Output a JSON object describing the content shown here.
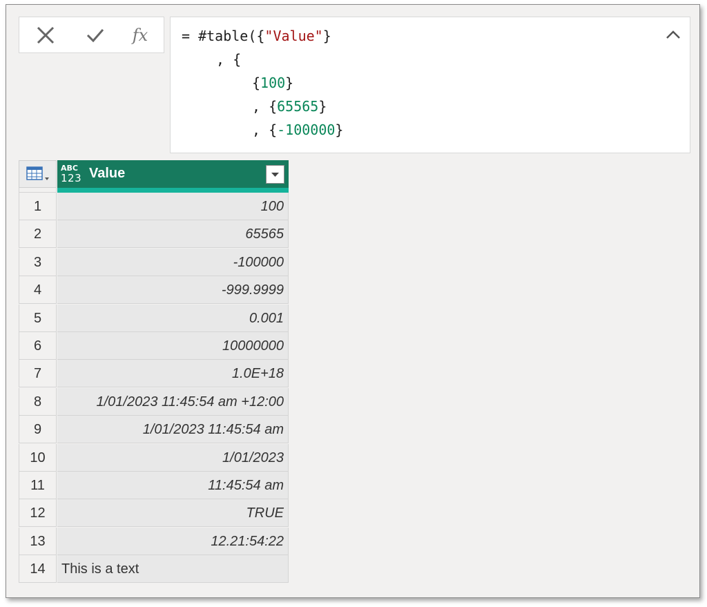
{
  "toolbar": {
    "cancel_icon": "close-icon",
    "commit_icon": "check-icon",
    "fx_label": "fx"
  },
  "formula": {
    "lines": [
      [
        "= #table({",
        "\"Value\"",
        "}"
      ],
      [
        ", {"
      ],
      [
        "{",
        "100",
        "}"
      ],
      [
        ", {",
        "65565",
        "}"
      ],
      [
        ", {",
        "-100000",
        "}"
      ]
    ]
  },
  "table": {
    "type_icon_top": "ABC",
    "type_icon_bottom": "123",
    "column_header": "Value",
    "rows": [
      {
        "num": "1",
        "value": "100"
      },
      {
        "num": "2",
        "value": "65565"
      },
      {
        "num": "3",
        "value": "-100000"
      },
      {
        "num": "4",
        "value": "-999.9999"
      },
      {
        "num": "5",
        "value": "0.001"
      },
      {
        "num": "6",
        "value": "10000000"
      },
      {
        "num": "7",
        "value": "1.0E+18"
      },
      {
        "num": "8",
        "value": "1/01/2023 11:45:54 am +12:00"
      },
      {
        "num": "9",
        "value": "1/01/2023 11:45:54 am"
      },
      {
        "num": "10",
        "value": "1/01/2023"
      },
      {
        "num": "11",
        "value": "11:45:54 am"
      },
      {
        "num": "12",
        "value": "TRUE"
      },
      {
        "num": "13",
        "value": "12.21:54:22"
      },
      {
        "num": "14",
        "value": "This is a text"
      }
    ]
  },
  "colors": {
    "header_bg": "#177a5e",
    "header_accent": "#16b39b",
    "string_literal": "#a31515",
    "number_literal": "#098658"
  }
}
